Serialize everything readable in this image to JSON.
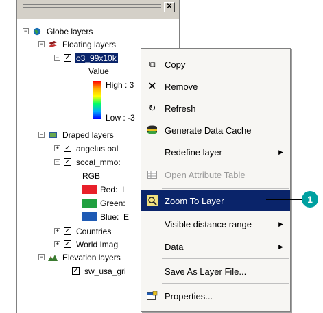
{
  "tree": {
    "globe_layers": "Globe layers",
    "floating_layers": "Floating layers",
    "o3_layer": "o3_99x10k",
    "value_label": "Value",
    "high_label": "High : 3",
    "low_label": "Low : -3",
    "draped_layers": "Draped layers",
    "angelus": "angelus oal",
    "socal": "socal_mmo:",
    "rgb_label": "RGB",
    "red_label": "Red:",
    "red_suffix": "I",
    "green_label": "Green:",
    "blue_label": "Blue:",
    "blue_suffix": "E",
    "countries": "Countries",
    "world_imag": "World Imag",
    "elevation_layers": "Elevation layers",
    "sw_usa": "sw_usa_gri"
  },
  "menu": {
    "items": [
      {
        "label": "Copy",
        "icon": "copy-icon",
        "enabled": true
      },
      {
        "label": "Remove",
        "icon": "remove-icon",
        "enabled": true
      },
      {
        "label": "Refresh",
        "icon": "refresh-icon",
        "enabled": true
      },
      {
        "label": "Generate Data Cache",
        "icon": "data-cache-icon",
        "enabled": true
      },
      {
        "label": "Redefine layer",
        "icon": "",
        "enabled": true,
        "submenu": true
      },
      {
        "label": "Open Attribute Table",
        "icon": "table-icon",
        "enabled": false
      },
      {
        "label": "Zoom To Layer",
        "icon": "zoom-to-layer-icon",
        "enabled": true,
        "highlighted": true
      },
      {
        "label": "Visible distance range",
        "icon": "",
        "enabled": true,
        "submenu": true
      },
      {
        "label": "Data",
        "icon": "",
        "enabled": true,
        "submenu": true
      },
      {
        "label": "Save As Layer File...",
        "icon": "",
        "enabled": true
      },
      {
        "label": "Properties...",
        "icon": "properties-icon",
        "enabled": true
      }
    ]
  },
  "callout": {
    "number": "1"
  },
  "colors": {
    "highlight": "#0a246a",
    "callout": "#00a0a0",
    "menu_bg": "#f7f6f3"
  }
}
